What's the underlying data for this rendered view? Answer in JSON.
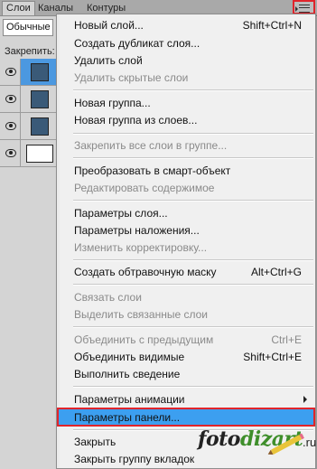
{
  "panel": {
    "tabs": [
      "Слои",
      "Каналы",
      "Контуры"
    ],
    "blend_mode": "Обычные",
    "lock_label": "Закрепить:",
    "menu_button_icon": "panel-menu-icon",
    "layers": [
      {
        "visible": true,
        "selected": true,
        "thumb_color": "#3a5a78"
      },
      {
        "visible": true,
        "selected": false,
        "thumb_color": "#3a5a78"
      },
      {
        "visible": true,
        "selected": false,
        "thumb_color": "#3a5a78"
      },
      {
        "visible": true,
        "selected": false,
        "thumb_color": "#ffffff"
      }
    ]
  },
  "menu": {
    "items": [
      {
        "label": "Новый слой...",
        "shortcut": "Shift+Ctrl+N",
        "disabled": false
      },
      {
        "label": "Создать дубликат слоя...",
        "shortcut": "",
        "disabled": false
      },
      {
        "label": "Удалить слой",
        "shortcut": "",
        "disabled": false
      },
      {
        "label": "Удалить скрытые слои",
        "shortcut": "",
        "disabled": true
      },
      {
        "label": "Новая группа...",
        "shortcut": "",
        "disabled": false
      },
      {
        "label": "Новая группа из слоев...",
        "shortcut": "",
        "disabled": false
      },
      {
        "label": "Закрепить все слои в группе...",
        "shortcut": "",
        "disabled": true
      },
      {
        "label": "Преобразовать в смарт-объект",
        "shortcut": "",
        "disabled": false
      },
      {
        "label": "Редактировать содержимое",
        "shortcut": "",
        "disabled": true
      },
      {
        "label": "Параметры слоя...",
        "shortcut": "",
        "disabled": false
      },
      {
        "label": "Параметры наложения...",
        "shortcut": "",
        "disabled": false
      },
      {
        "label": "Изменить корректировку...",
        "shortcut": "",
        "disabled": true
      },
      {
        "label": "Создать обтравочную маску",
        "shortcut": "Alt+Ctrl+G",
        "disabled": false
      },
      {
        "label": "Связать слои",
        "shortcut": "",
        "disabled": true
      },
      {
        "label": "Выделить связанные слои",
        "shortcut": "",
        "disabled": true
      },
      {
        "label": "Объединить с предыдущим",
        "shortcut": "Ctrl+E",
        "disabled": true
      },
      {
        "label": "Объединить видимые",
        "shortcut": "Shift+Ctrl+E",
        "disabled": false
      },
      {
        "label": "Выполнить сведение",
        "shortcut": "",
        "disabled": false
      },
      {
        "label": "Параметры анимации",
        "shortcut": "",
        "disabled": false,
        "submenu": true
      },
      {
        "label": "Параметры панели...",
        "shortcut": "",
        "disabled": false,
        "highlighted": true
      },
      {
        "label": "Закрыть",
        "shortcut": "",
        "disabled": false
      },
      {
        "label": "Закрыть группу вкладок",
        "shortcut": "",
        "disabled": false
      }
    ]
  },
  "watermark": {
    "part1": "foto",
    "part2": "dizart",
    "domain": ".ru"
  },
  "colors": {
    "highlight": "#3c9ff0",
    "annotation_red": "#e0242b",
    "layer_selected": "#4b98e0"
  }
}
